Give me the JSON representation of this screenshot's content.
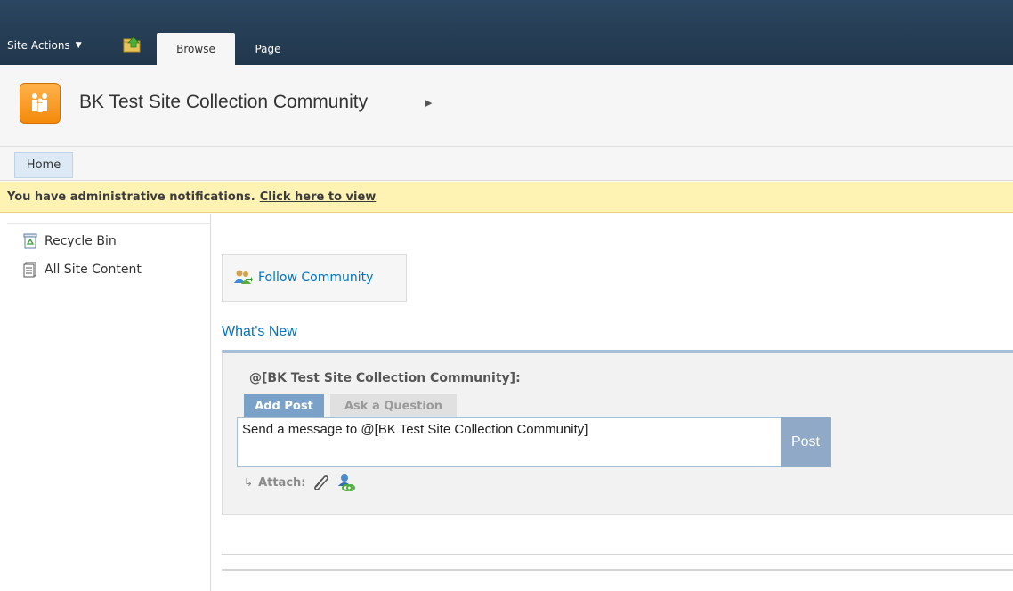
{
  "ribbon": {
    "site_actions_label": "Site Actions",
    "tabs": [
      {
        "label": "Browse",
        "selected": true
      },
      {
        "label": "Page",
        "selected": false
      }
    ],
    "nav_icon": "folder-up-icon"
  },
  "site": {
    "title": "BK Test Site Collection Community",
    "logo_icon": "community-people-icon"
  },
  "topnav": {
    "items": [
      {
        "label": "Home",
        "selected": true
      }
    ]
  },
  "notification": {
    "message": "You have administrative notifications.",
    "link_text": "Click here to view"
  },
  "leftnav": {
    "items": [
      {
        "label": "Recycle Bin",
        "icon": "recycle-bin-icon"
      },
      {
        "label": "All Site Content",
        "icon": "site-content-icon"
      }
    ]
  },
  "main": {
    "follow_label": "Follow Community",
    "whats_new_heading": "What's New",
    "post": {
      "heading": "@[BK Test Site Collection Community]:",
      "tabs": [
        {
          "label": "Add Post",
          "selected": true
        },
        {
          "label": "Ask a Question",
          "selected": false
        }
      ],
      "input_text": "Send a message to @[BK Test Site Collection Community]",
      "post_button": "Post",
      "attach_label": "Attach:",
      "attach_arrow": "↳"
    }
  },
  "colors": {
    "ribbon_bg": "#21374c",
    "link_blue": "#0072c6",
    "notification_bg": "#fff3b3",
    "post_button_bg": "#8fa9c6"
  }
}
